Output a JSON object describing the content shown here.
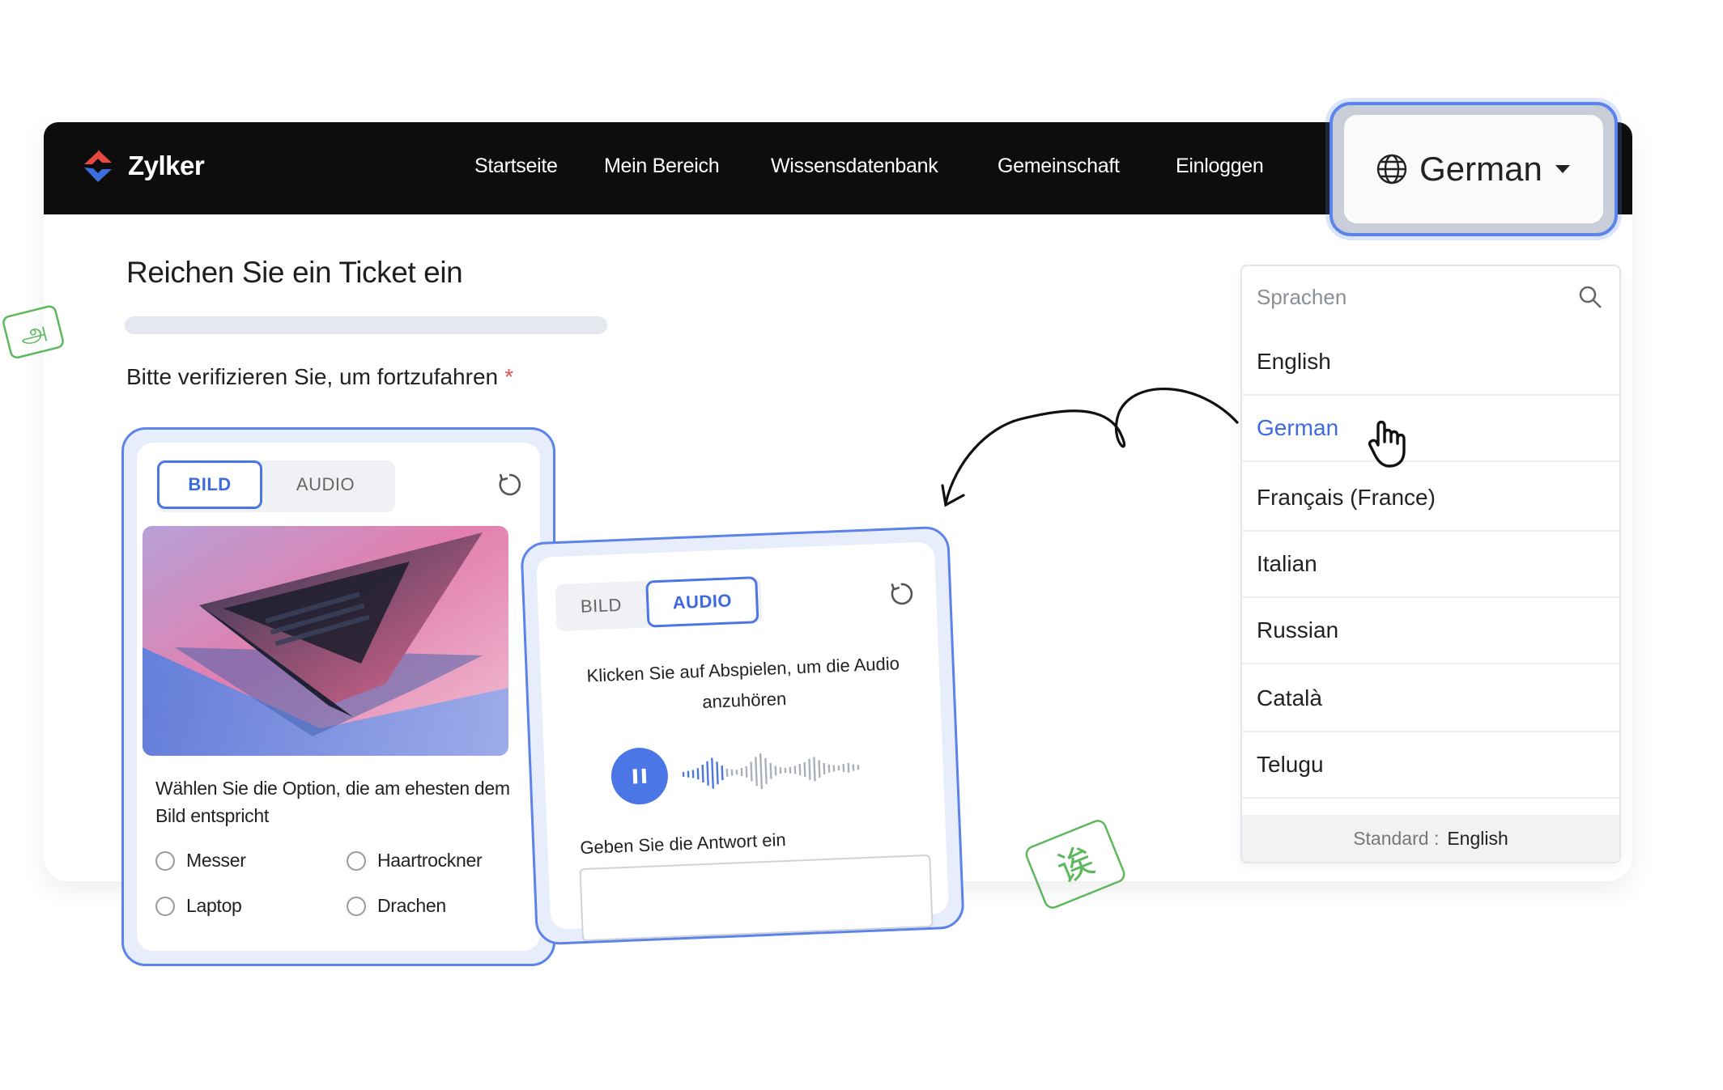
{
  "brand": {
    "name": "Zylker",
    "colors": {
      "red": "#e8483f",
      "blue": "#3b6fe0"
    }
  },
  "nav": {
    "links": [
      "Startseite",
      "Mein Bereich",
      "Wissensdatenbank",
      "Gemeinschaft",
      "Einloggen"
    ]
  },
  "language_selector": {
    "current": "German",
    "icon": "globe-icon",
    "caret": "caret-down-icon"
  },
  "form": {
    "title": "Reichen Sie ein Ticket ein",
    "verify_label": "Bitte verifizieren Sie, um fortzufahren",
    "required_mark": "*"
  },
  "image_captcha": {
    "tabs": [
      "BILD",
      "AUDIO"
    ],
    "active_tab": "BILD",
    "question": "Wählen Sie die Option, die am ehesten dem Bild entspricht",
    "options": [
      "Messer",
      "Haartrockner",
      "Laptop",
      "Drachen"
    ]
  },
  "audio_captcha": {
    "tabs": [
      "BILD",
      "AUDIO"
    ],
    "active_tab": "AUDIO",
    "instruction": "Klicken Sie auf Abspielen, um die Audio anzuhören",
    "answer_label": "Geben Sie die Antwort ein",
    "answer_value": "",
    "play_state": "pause"
  },
  "language_dropdown": {
    "search_placeholder": "Sprachen",
    "items": [
      "English",
      "German",
      "Français (France)",
      "Italian",
      "Russian",
      "Català",
      "Telugu"
    ],
    "selected": "German",
    "default_label": "Standard :",
    "default_value": "English"
  },
  "decorations": {
    "stamp_left_glyph": "அ",
    "stamp_right_glyph": "诶",
    "stamp_color": "#5cb85c"
  },
  "colors": {
    "accent": "#4a76e6",
    "navbar": "#0d0d0d"
  }
}
